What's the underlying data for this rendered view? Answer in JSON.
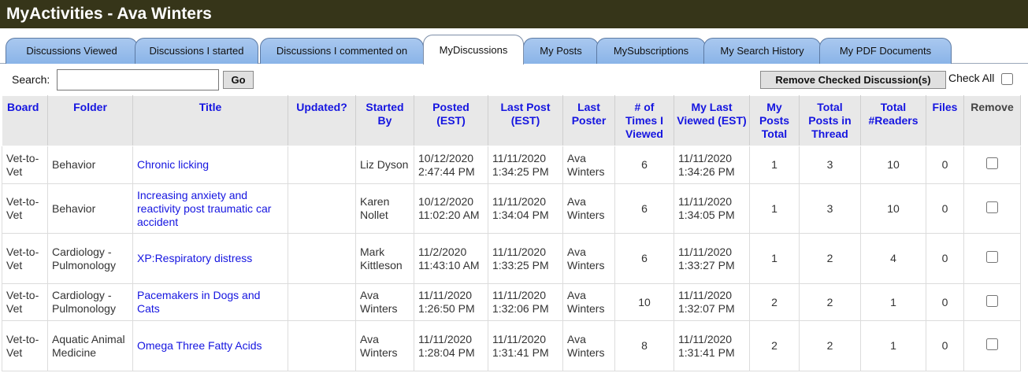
{
  "title": "MyActivities - Ava Winters",
  "tabs": [
    {
      "label": "Discussions Viewed"
    },
    {
      "label": "Discussions I started"
    },
    {
      "label": "Discussions I commented on"
    },
    {
      "label": "MyDiscussions",
      "active": true
    },
    {
      "label": "My Posts"
    },
    {
      "label": "MySubscriptions"
    },
    {
      "label": "My Search History"
    },
    {
      "label": "My PDF Documents"
    }
  ],
  "toolbar": {
    "search_label": "Search:",
    "search_value": "",
    "go_label": "Go",
    "remove_label": "Remove Checked Discussion(s)",
    "check_all_label": "Check All"
  },
  "table": {
    "headers": {
      "board": "Board",
      "folder": "Folder",
      "title": "Title",
      "updated": "Updated?",
      "started_by": "Started By",
      "posted": "Posted (EST)",
      "last_post": "Last Post (EST)",
      "last_poster": "Last Poster",
      "times_viewed": "# of Times I Viewed",
      "my_last_viewed": "My Last Viewed (EST)",
      "my_posts_total": "My Posts Total",
      "total_posts": "Total Posts in Thread",
      "total_readers": "Total #Readers",
      "files": "Files",
      "remove": "Remove"
    },
    "rows": [
      {
        "board": "Vet-to-Vet",
        "folder": "Behavior",
        "title": "Chronic licking",
        "updated": "",
        "started_by": "Liz Dyson",
        "posted": "10/12/2020 2:47:44 PM",
        "last_post": "11/11/2020 1:34:25 PM",
        "last_poster": "Ava Winters",
        "times_viewed": "6",
        "my_last_viewed": "11/11/2020 1:34:26 PM",
        "my_posts_total": "1",
        "total_posts": "3",
        "total_readers": "10",
        "files": "0"
      },
      {
        "board": "Vet-to-Vet",
        "folder": "Behavior",
        "title": "Increasing anxiety and reactivity post traumatic car accident",
        "updated": "",
        "started_by": "Karen Nollet",
        "posted": "10/12/2020 11:02:20 AM",
        "last_post": "11/11/2020 1:34:04 PM",
        "last_poster": "Ava Winters",
        "times_viewed": "6",
        "my_last_viewed": "11/11/2020 1:34:05 PM",
        "my_posts_total": "1",
        "total_posts": "3",
        "total_readers": "10",
        "files": "0"
      },
      {
        "board": "Vet-to-Vet",
        "folder": "Cardiology - Pulmonology",
        "title": "XP:Respiratory distress",
        "updated": "",
        "started_by": "Mark Kittleson",
        "posted": "11/2/2020 11:43:10 AM",
        "last_post": "11/11/2020 1:33:25 PM",
        "last_poster": "Ava Winters",
        "times_viewed": "6",
        "my_last_viewed": "11/11/2020 1:33:27 PM",
        "my_posts_total": "1",
        "total_posts": "2",
        "total_readers": "4",
        "files": "0"
      },
      {
        "board": "Vet-to-Vet",
        "folder": "Cardiology - Pulmonology",
        "title": "Pacemakers in Dogs and Cats",
        "updated": "",
        "started_by": "Ava Winters",
        "posted": "11/11/2020 1:26:50 PM",
        "last_post": "11/11/2020 1:32:06 PM",
        "last_poster": "Ava Winters",
        "times_viewed": "10",
        "my_last_viewed": "11/11/2020 1:32:07 PM",
        "my_posts_total": "2",
        "total_posts": "2",
        "total_readers": "1",
        "files": "0"
      },
      {
        "board": "Vet-to-Vet",
        "folder": "Aquatic Animal Medicine",
        "title": "Omega Three Fatty Acids",
        "updated": "",
        "started_by": "Ava Winters",
        "posted": "11/11/2020 1:28:04 PM",
        "last_post": "11/11/2020 1:31:41 PM",
        "last_poster": "Ava Winters",
        "times_viewed": "8",
        "my_last_viewed": "11/11/2020 1:31:41 PM",
        "my_posts_total": "2",
        "total_posts": "2",
        "total_readers": "1",
        "files": "0"
      }
    ]
  }
}
